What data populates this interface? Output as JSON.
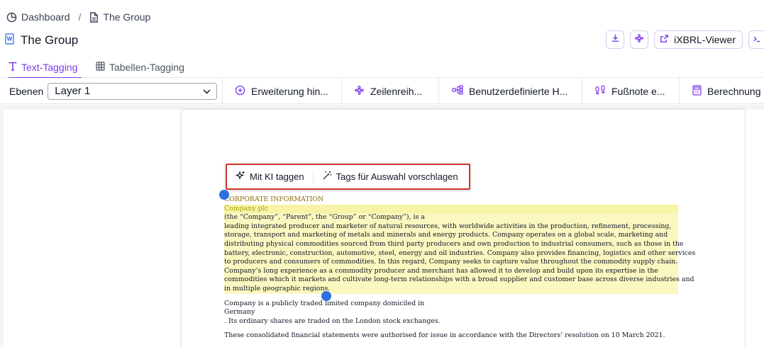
{
  "breadcrumb": {
    "root": "Dashboard",
    "separator": "/",
    "current": "The Group"
  },
  "header": {
    "title": "The Group",
    "ixbrl_label": "iXBRL-Viewer"
  },
  "tabs": [
    {
      "label": "Text-Tagging",
      "active": true
    },
    {
      "label": "Tabellen-Tagging",
      "active": false
    }
  ],
  "toolbar": {
    "layer_label": "Ebenen",
    "layer_value": "Layer 1",
    "items": [
      {
        "label": "Erweiterung hin...",
        "icon": "plus-circle-icon"
      },
      {
        "label": "Zeilenreih...",
        "icon": "flower-icon"
      },
      {
        "label": "Benutzerdefinierte H...",
        "icon": "hierarchy-icon"
      },
      {
        "label": "Fußnote e...",
        "icon": "footprints-icon"
      },
      {
        "label": "Berechnung",
        "icon": "calculator-icon"
      }
    ]
  },
  "ai_toolbar": {
    "tag_ai": "Mit KI taggen",
    "suggest": "Tags für Auswahl vorschlagen"
  },
  "document": {
    "heading": "CORPORATE INFORMATION",
    "company": "Company plc",
    "lines": [
      "(the “Company”, “Parent”, the “Group” or “Company”), is a",
      "leading integrated producer and marketer of natural resources, with worldwide activities in the production, refinement, processing,",
      "storage, transport and marketing of metals and minerals and energy products. Company operates on a global scale, marketing and",
      "distributing physical commodities sourced from third party producers and own production to industrial consumers, such as those in the",
      "battery, electronic, construction, automotive, steel, energy and oil industries. Company also provides financing, logistics and other services",
      "to producers and consumers of commodities. In this regard, Company seeks to capture value throughout the commodity supply chain.",
      "Company’s long experience as a commodity producer and merchant has allowed it to develop and build upon its expertise in the",
      "commodities which it markets and cultivate long-term relationships with a broad supplier and customer base across diverse industries and",
      "in multiple geographic regions."
    ],
    "para2": [
      "Company is a publicly traded limited company domiciled in",
      "Germany",
      ". Its ordinary shares are traded on the London stock exchanges."
    ],
    "para3": "These consolidated financial statements were authorised for issue in accordance with the Directors’ resolution on 10 March 2021."
  },
  "colors": {
    "accent": "#7c3aed",
    "highlight": "#fbf7c0",
    "selection_handle": "#2f6fe0",
    "ai_bar_border": "#d0342c"
  }
}
